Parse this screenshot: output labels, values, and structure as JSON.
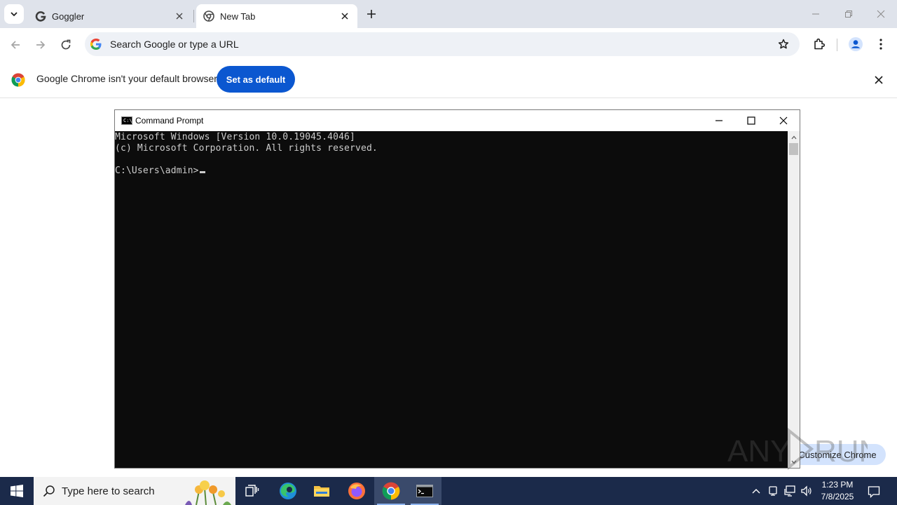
{
  "browser": {
    "tabs": [
      {
        "title": "Goggler",
        "favicon": "goggler-favicon-icon",
        "active": false
      },
      {
        "title": "New Tab",
        "favicon": "chrome-newtab-icon",
        "active": true
      }
    ],
    "omnibox": {
      "placeholder": "Search Google or type a URL"
    },
    "infobar": {
      "message": "Google Chrome isn't your default browser",
      "button_label": "Set as default"
    },
    "customize_label": "Customize Chrome",
    "colors": {
      "accent": "#0b57d0",
      "tabstrip": "#dfe3eb"
    }
  },
  "cmd": {
    "title": "Command Prompt",
    "lines": [
      "Microsoft Windows [Version 10.0.19045.4046]",
      "(c) Microsoft Corporation. All rights reserved.",
      "",
      "C:\\Users\\admin>"
    ]
  },
  "watermark": {
    "text": "ANY RUN"
  },
  "taskbar": {
    "search_placeholder": "Type here to search",
    "apps": [
      "task-view-icon",
      "edge-icon",
      "file-explorer-icon",
      "firefox-icon",
      "chrome-icon",
      "cmd-icon"
    ],
    "clock": {
      "time": "1:23 PM",
      "date": "7/8/2025"
    },
    "colors": {
      "background": "#1b2a4a"
    }
  }
}
